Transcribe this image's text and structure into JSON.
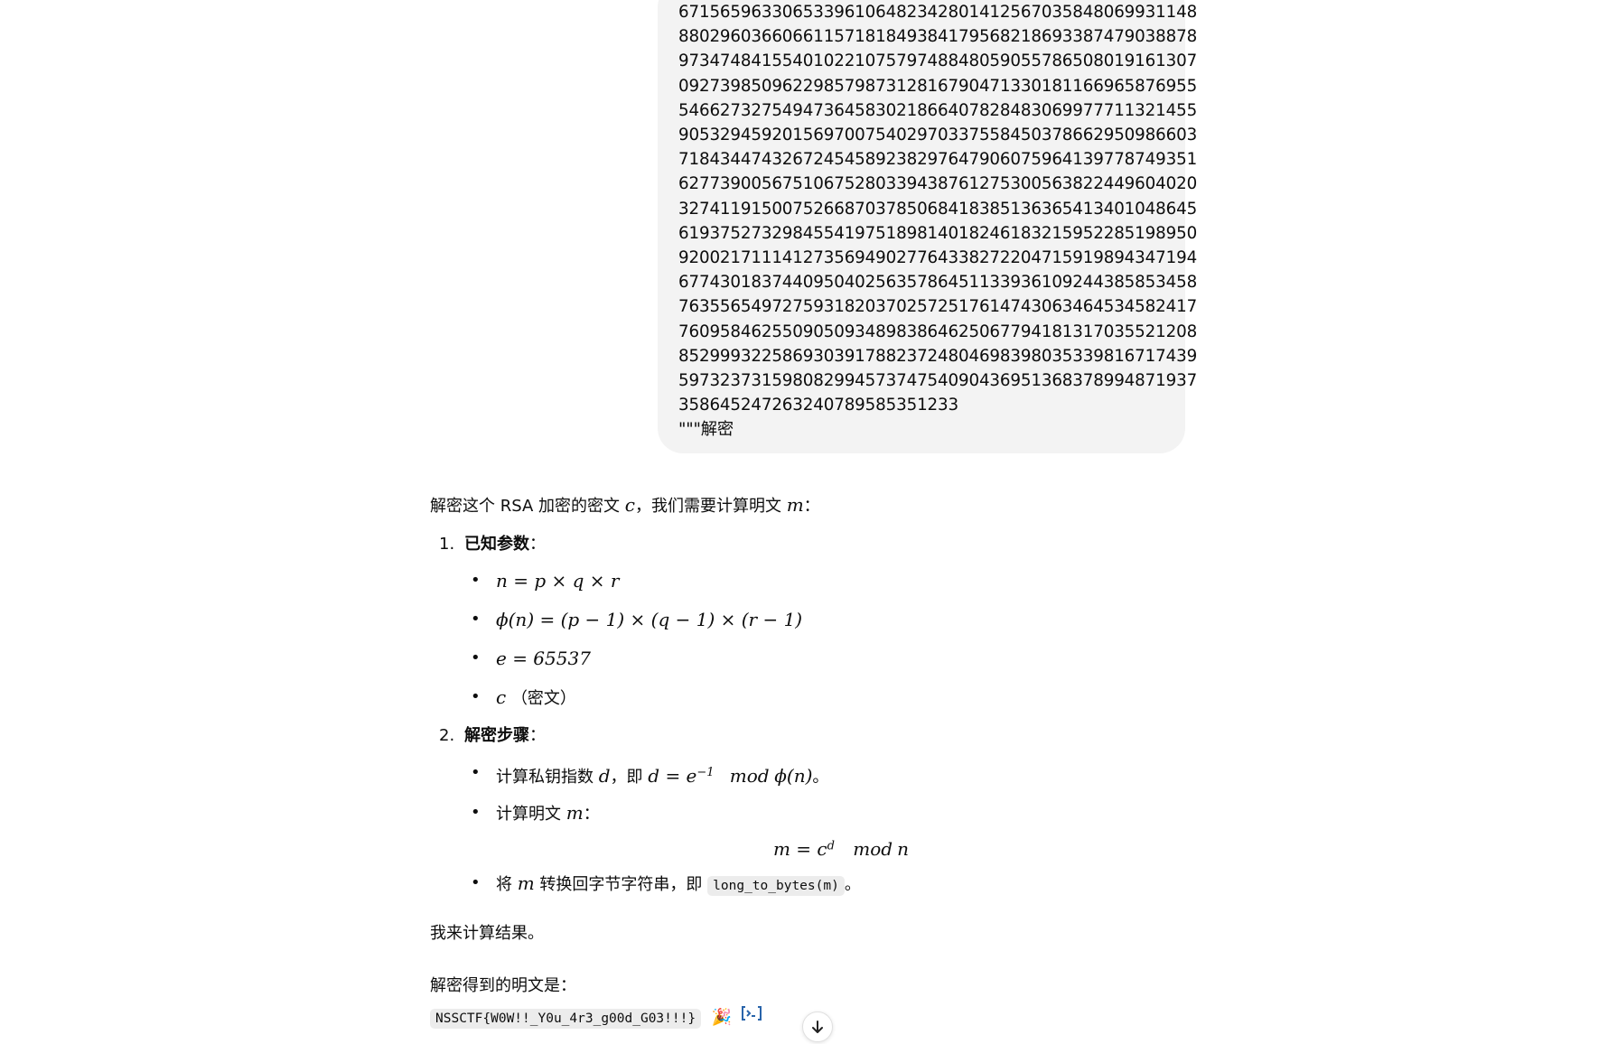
{
  "user_message": {
    "cipher_lines": [
      "6715659633065339610648234280141256703584806993 1148",
      "8802960366066115718184938417956821869338747903 8878",
      "9734748415540102210757974884805905578650801916 1307",
      "0927398509622985798731281679047133018116696587 6955",
      "5466273275494736458302186640782848306997771132 1455",
      "9053294592015697007540297033755845037866295098 6603",
      "7184344743267245458923829764790607596413977874 9351",
      "6277390056751067528033943876127530056382244960 4020",
      "3274119150075266870378506841838513636541340104 8645",
      "6193752732984554197518981401824618321595228519 8950",
      "9200217111412735694902776433827220471591989434 7194",
      "6774301837440950402563578645113393610924438585 3458",
      "7635565497275931820370257251761474306346453458 2417",
      "7609584625509050934898386462506779418131703552 1208",
      "8529993225869303917882372480469839803533981671 7439",
      "5973237315980829945737475409043695136837899487 1937",
      "3586452472632407895853512 33"
    ],
    "closing_text": "\"\"\"解密"
  },
  "assistant": {
    "intro_prefix": "解密这个 RSA 加密的密文 ",
    "intro_var_c": "c",
    "intro_middle": "，我们需要计算明文 ",
    "intro_var_m": "m",
    "intro_suffix": "：",
    "section1_num": "1.",
    "section1_title": "已知参数",
    "section1_colon": "：",
    "params": {
      "n_formula": "n = p × q × r",
      "phi_formula": "ϕ(n) = (p − 1) × (q − 1) × (r − 1)",
      "e_formula": "e = 65537",
      "c_var": "c",
      "c_note": "（密文）"
    },
    "section2_num": "2.",
    "section2_title": "解密步骤",
    "section2_colon": "：",
    "step1_prefix": "计算私钥指数 ",
    "step1_var_d": "d",
    "step1_middle": "，即 ",
    "step1_formula_lhs": "d = e",
    "step1_formula_exp": "−1",
    "step1_formula_mod": "mod",
    "step1_formula_rhs": "ϕ(n)",
    "step1_suffix": "。",
    "step2_prefix": "计算明文 ",
    "step2_var_m": "m",
    "step2_suffix": "：",
    "display_lhs": "m = c",
    "display_exp": "d",
    "display_mod": "mod",
    "display_rhs": "n",
    "step3_prefix": "将 ",
    "step3_var_m": "m",
    "step3_middle": " 转换回字节字符串，即 ",
    "step3_code": "long_to_bytes(m)",
    "step3_suffix": "。",
    "compute_text": "我来计算结果。",
    "result_label": "解密得到的明文是：",
    "result_flag": "NSSCTF{W0W!!_Y0u_4r3_g00d_G03!!!}",
    "party_emoji": "🎉"
  },
  "icons": {
    "code_interpreter": "code-interpreter-icon",
    "scroll_down": "arrow-down-icon"
  },
  "colors": {
    "bubble_bg": "#f3f3f3",
    "code_bg": "#ececec",
    "accent_blue": "#2964aa"
  }
}
